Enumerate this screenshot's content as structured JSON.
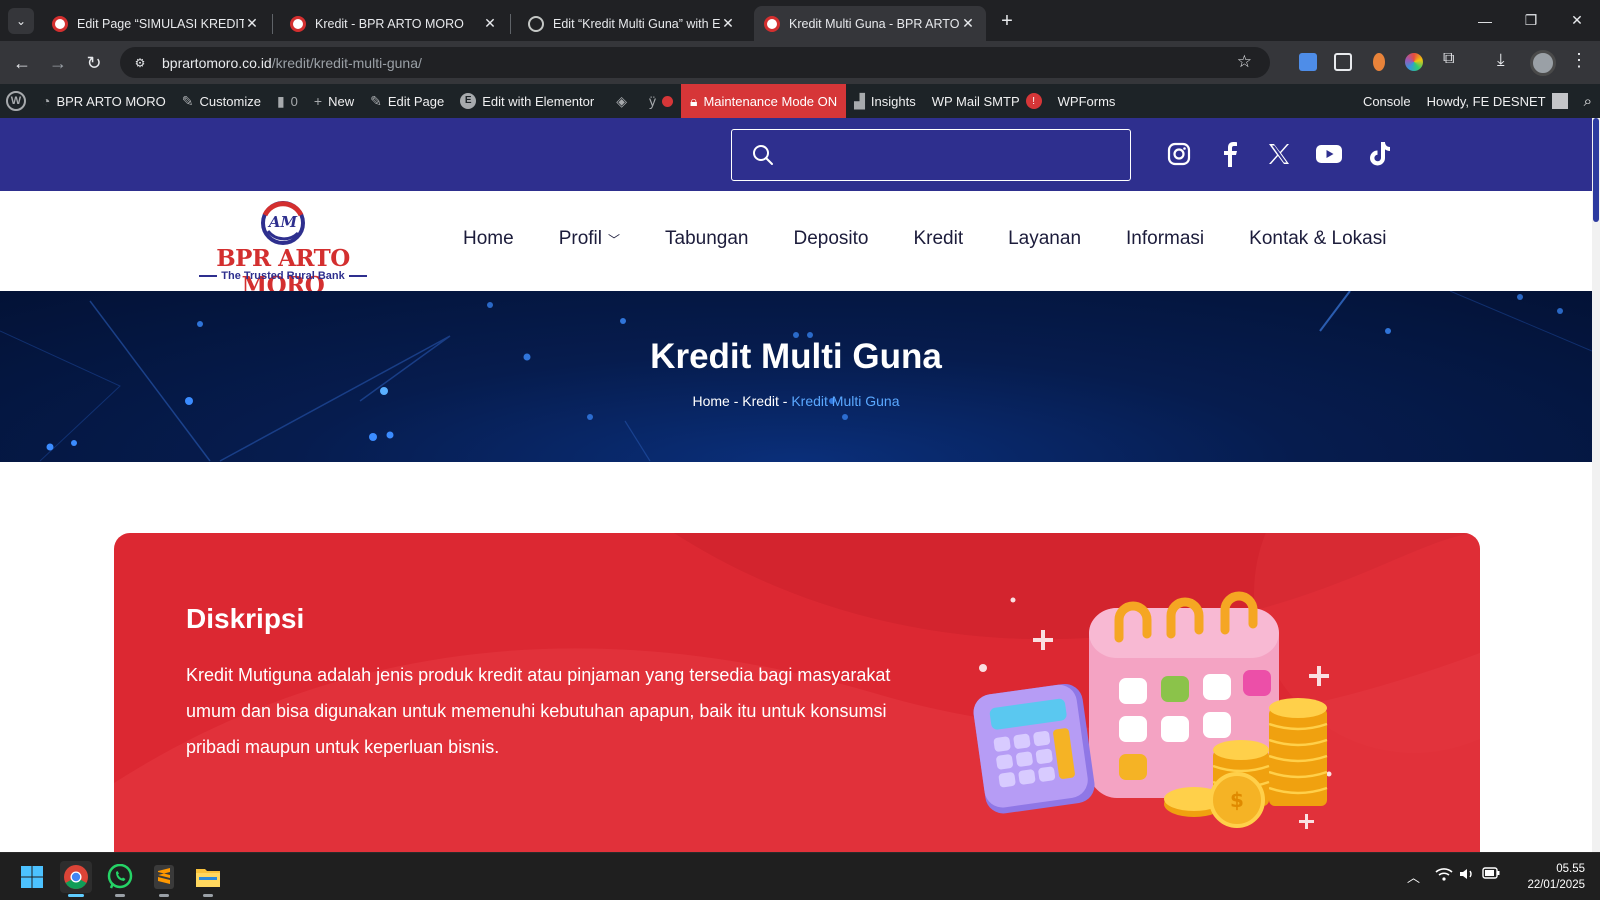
{
  "browser": {
    "tabs": [
      {
        "title": "Edit Page “SIMULASI KREDIT BPR",
        "favicon": "bpr-logo"
      },
      {
        "title": "Kredit - BPR ARTO MORO",
        "favicon": "bpr-logo"
      },
      {
        "title": "Edit “Kredit Multi Guna” with El",
        "favicon": "globe"
      },
      {
        "title": "Kredit Multi Guna - BPR ARTO M",
        "favicon": "bpr-logo",
        "active": true
      }
    ],
    "url_host": "bprartomoro.co.id",
    "url_path": "/kredit/kredit-multi-guna/"
  },
  "adminbar": {
    "site_name": "BPR ARTO MORO",
    "customize": "Customize",
    "comments_count": "0",
    "new": "New",
    "edit_page": "Edit Page",
    "edit_elementor": "Edit with Elementor",
    "maintenance": "Maintenance Mode ON",
    "insights": "Insights",
    "wp_mail_smtp": "WP Mail SMTP",
    "wp_mail_badge": "!",
    "wpforms": "WPForms",
    "console": "Console",
    "howdy": "Howdy, FE DESNET"
  },
  "site": {
    "logo_title": "BPR ARTO MORO",
    "logo_tagline": "The Trusted Rural Bank",
    "logo_monogram": "AM",
    "menu": [
      "Home",
      "Profil",
      "Tabungan",
      "Deposito",
      "Kredit",
      "Layanan",
      "Informasi",
      "Kontak & Lokasi"
    ],
    "social_icons": [
      "instagram-icon",
      "facebook-icon",
      "x-icon",
      "youtube-icon",
      "tiktok-icon"
    ],
    "colors": {
      "primary": "#2e2f8e",
      "accent": "#dc2832",
      "link": "#5aa8ff"
    }
  },
  "hero": {
    "title": "Kredit Multi Guna",
    "breadcrumb": [
      "Home",
      "Kredit",
      "Kredit Multi Guna"
    ],
    "separator": "-"
  },
  "card": {
    "heading": "Diskripsi",
    "body": "Kredit Mutiguna adalah jenis produk kredit atau pinjaman yang tersedia bagi masyarakat umum dan bisa digunakan untuk memenuhi kebutuhan apapun, baik itu untuk konsumsi pribadi maupun untuk keperluan bisnis."
  },
  "taskbar": {
    "time": "05.55",
    "date": "22/01/2025"
  }
}
